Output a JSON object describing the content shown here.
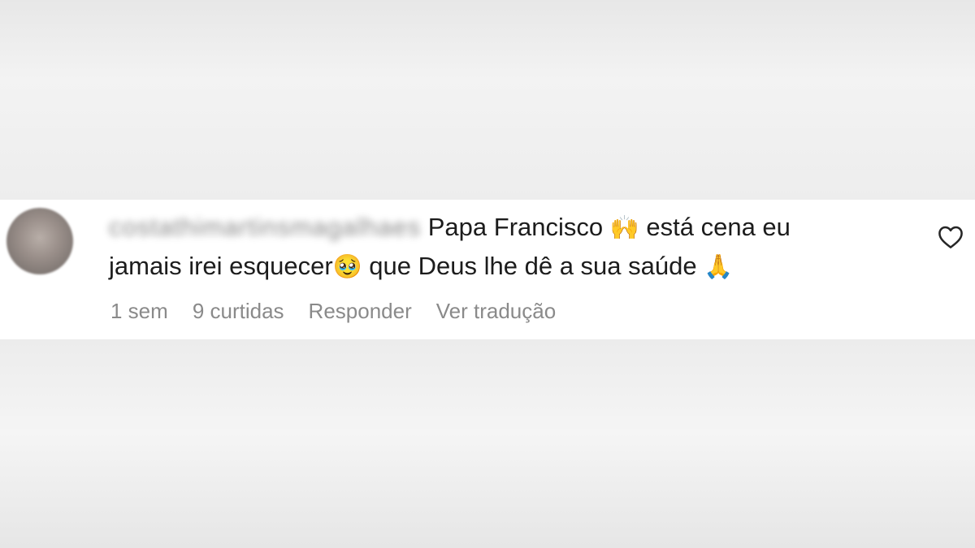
{
  "comment": {
    "username": "costathimartinsmagalhaes",
    "text_line1_a": "Papa Francisco",
    "emoji_raised_hands": "🙌",
    "text_line1_b": "está cena eu",
    "text_line2_a": "jamais irei esquecer",
    "emoji_crying": "🥹",
    "text_line2_b": "que Deus lhe dê a sua saúde",
    "emoji_pray": "🙏",
    "time_ago": "1 sem",
    "likes": "9 curtidas",
    "reply_label": "Responder",
    "translate_label": "Ver tradução"
  },
  "icons": {
    "like": "heart-outline-icon",
    "avatar": "user-avatar"
  },
  "colors": {
    "text": "#1c1c1c",
    "meta": "#8a8a8a",
    "card_background": "#ffffff",
    "page_background": "#eeeeee"
  }
}
